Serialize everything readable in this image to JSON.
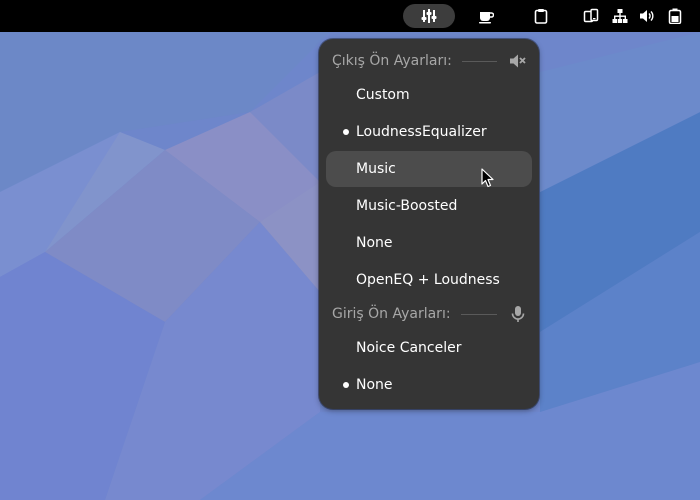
{
  "output_section": {
    "title": "Çıkış Ön Ayarları:",
    "icon": "speaker-muted-icon",
    "items": [
      {
        "label": "Custom",
        "selected": false
      },
      {
        "label": "LoudnessEqualizer",
        "selected": true
      },
      {
        "label": "Music",
        "selected": false,
        "hovered": true
      },
      {
        "label": "Music-Boosted",
        "selected": false
      },
      {
        "label": "None",
        "selected": false
      },
      {
        "label": "OpenEQ + Loudness",
        "selected": false
      }
    ]
  },
  "input_section": {
    "title": "Giriş Ön Ayarları:",
    "icon": "microphone-icon",
    "items": [
      {
        "label": "Noice Canceler",
        "selected": false
      },
      {
        "label": "None",
        "selected": true
      }
    ]
  },
  "topbar": {
    "icons": [
      "equalizer-icon",
      "coffee-cup-icon",
      "clipboard-icon",
      "display-phone-icon",
      "network-icon",
      "volume-icon",
      "battery-icon"
    ]
  },
  "colors": {
    "menu_bg": "#353535",
    "hover_bg": "#4c4c4c",
    "topbar_bg": "#000000",
    "section_text": "#a7a7a7",
    "item_text": "#ffffff"
  }
}
